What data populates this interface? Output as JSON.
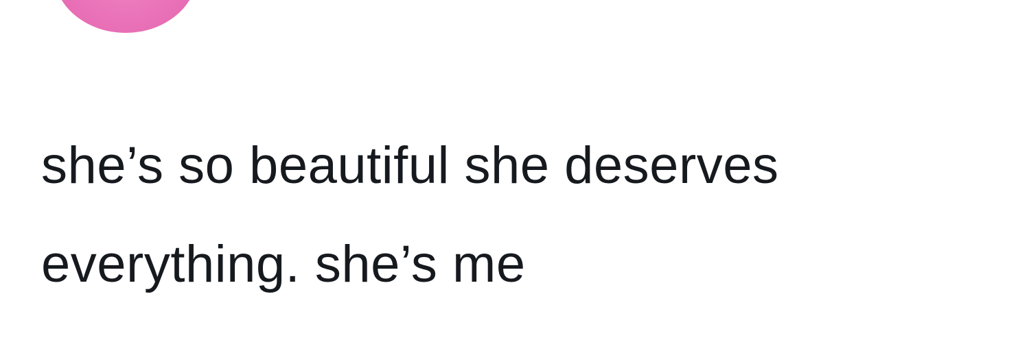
{
  "tweet": {
    "avatar_color": "#ea72b8",
    "text_lines": [
      "she’s so beautiful she deserves",
      "everything. she’s me"
    ]
  }
}
